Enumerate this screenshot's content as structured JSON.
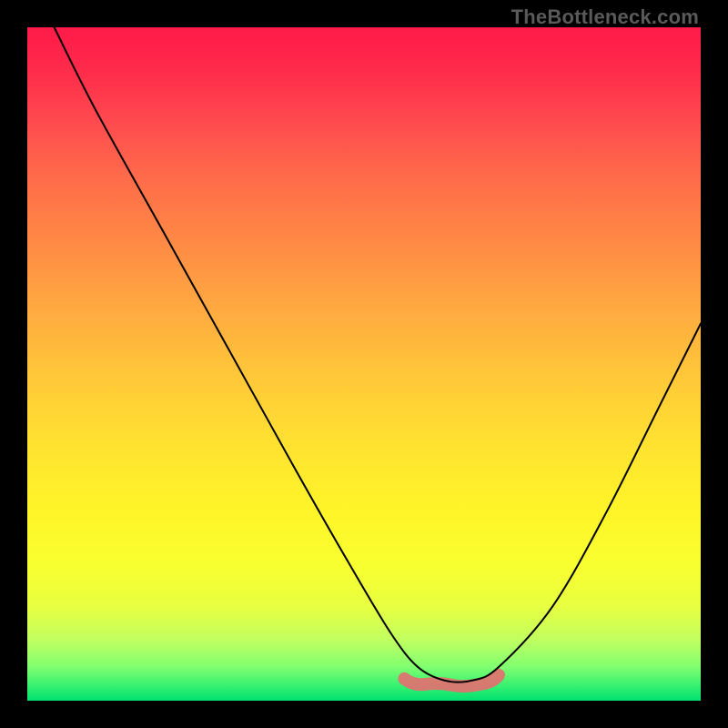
{
  "attribution": "TheBottleneck.com",
  "colors": {
    "background": "#000000",
    "attribution_text": "#5a5a5a",
    "curve": "#000000",
    "blob": "#e37070"
  },
  "chart_data": {
    "type": "line",
    "title": "",
    "xlabel": "",
    "ylabel": "",
    "xlim": [
      0,
      100
    ],
    "ylim": [
      0,
      100
    ],
    "series": [
      {
        "name": "curve",
        "x": [
          4,
          10,
          20,
          30,
          40,
          48,
          54,
          58,
          62,
          66,
          70,
          78,
          86,
          94,
          100
        ],
        "y": [
          100,
          88,
          70,
          52,
          34,
          20,
          10,
          5,
          3,
          3,
          5,
          14,
          28,
          44,
          56
        ]
      }
    ],
    "highlight_region": {
      "name": "optimal-zone",
      "x_range": [
        56,
        70
      ],
      "y_approx": 3
    }
  }
}
